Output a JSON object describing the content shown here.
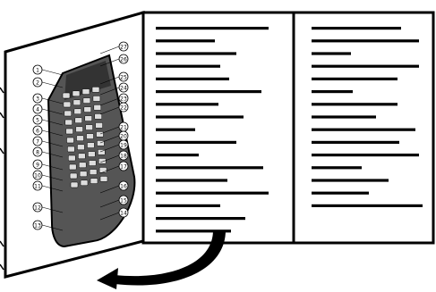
{
  "diagram": {
    "remote": {
      "brand_marking": "",
      "left_callouts": [
        "1",
        "2",
        "3",
        "4",
        "5",
        "6",
        "7",
        "8",
        "9",
        "10",
        "11",
        "12",
        "13"
      ],
      "right_callouts": [
        "27",
        "26",
        "25",
        "24",
        "23",
        "22",
        "21",
        "20",
        "19",
        "18",
        "17",
        "16",
        "15",
        "14"
      ]
    },
    "pages": [
      {
        "name": "middle-panel",
        "text_lines": 17
      },
      {
        "name": "right-panel",
        "text_lines": 15
      }
    ],
    "fold_arrow": {
      "direction": "from middle panel bottom, curving down-left to the left flap"
    },
    "colors": {
      "ink": "#000000",
      "paper": "#ffffff",
      "remote_body": "#555555",
      "button": "#dddddd"
    }
  }
}
